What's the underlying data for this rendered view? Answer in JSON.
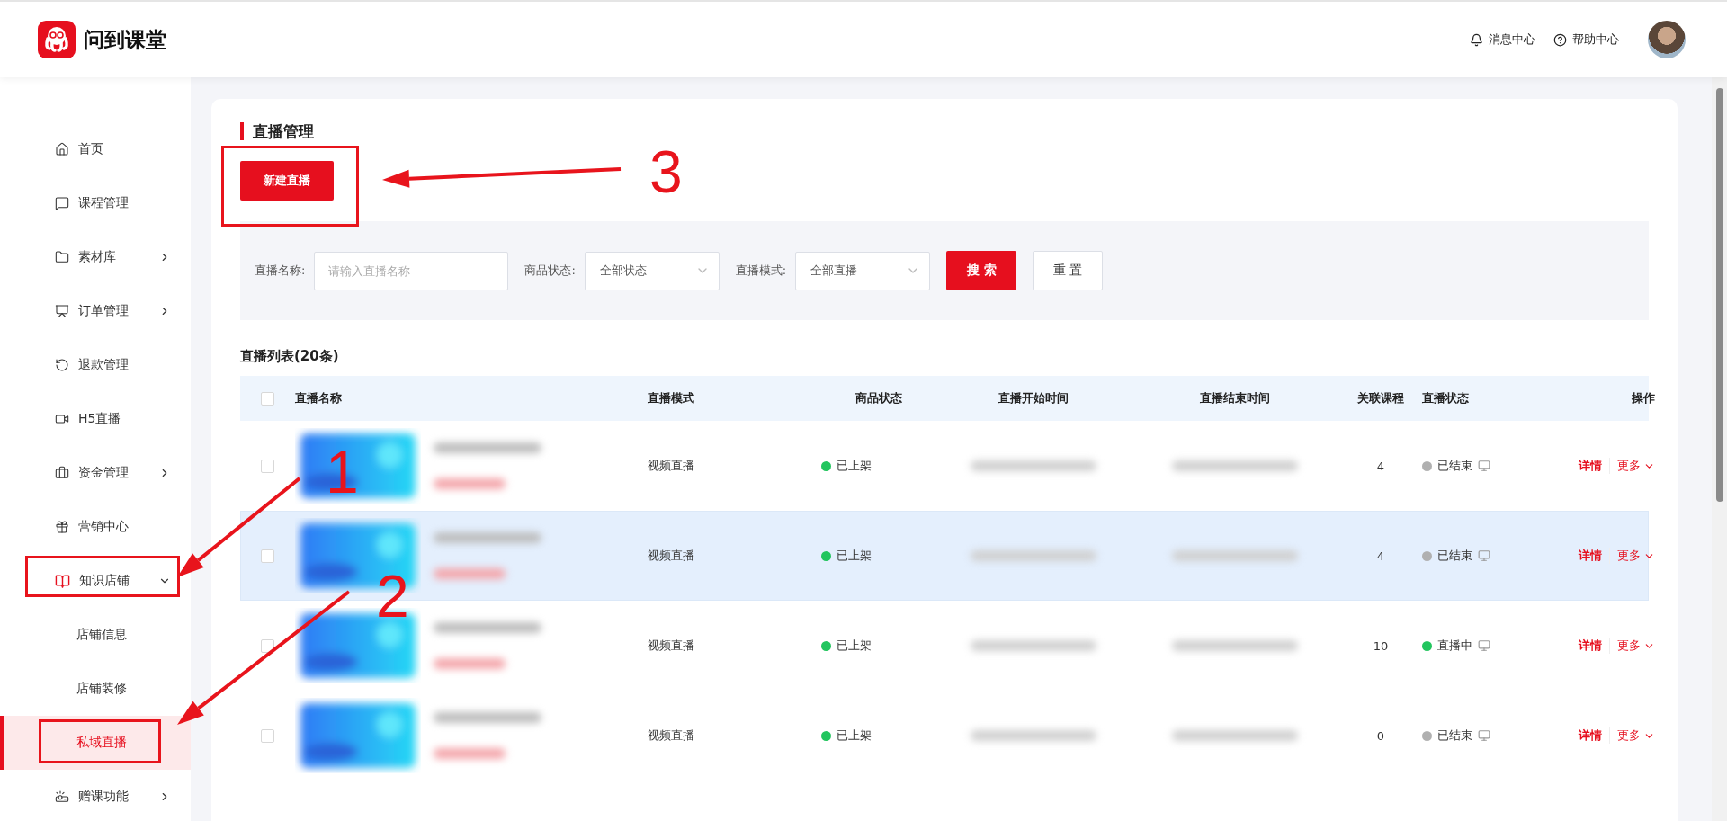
{
  "header": {
    "brand": "问到课堂",
    "links": [
      {
        "label": "消息中心"
      },
      {
        "label": "帮助中心"
      }
    ]
  },
  "sidebar": {
    "items": [
      {
        "label": "首页",
        "selected": false
      },
      {
        "label": "课程管理",
        "selected": false
      },
      {
        "label": "素材库",
        "expanded": false,
        "selected": false
      },
      {
        "label": "订单管理",
        "expanded": false,
        "selected": false
      },
      {
        "label": "退款管理",
        "selected": false
      },
      {
        "label": "H5直播",
        "selected": false
      },
      {
        "label": "资金管理",
        "expanded": false,
        "selected": false
      },
      {
        "label": "营销中心",
        "selected": false
      },
      {
        "label": "知识店铺",
        "expanded": true,
        "selected": false,
        "children": [
          {
            "label": "店铺信息",
            "selected": false
          },
          {
            "label": "店铺装修",
            "selected": false
          },
          {
            "label": "私域直播",
            "selected": true
          }
        ]
      },
      {
        "label": "赠课功能",
        "expanded": false,
        "selected": false
      }
    ]
  },
  "page": {
    "title": "直播管理",
    "primary_button": "新建直播",
    "filters": {
      "name_label": "直播名称:",
      "name_placeholder": "请输入直播名称",
      "status_label": "商品状态:",
      "status_value": "全部状态",
      "mode_label": "直播模式:",
      "mode_value": "全部直播",
      "search_button": "搜 索",
      "reset_button": "重 置"
    },
    "list_title": "直播列表(20条)",
    "table": {
      "columns": [
        "直播名称",
        "直播模式",
        "商品状态",
        "直播开始时间",
        "直播结束时间",
        "关联课程",
        "直播状态",
        "操作"
      ],
      "select_all_checked": false,
      "rows": [
        {
          "checked": false,
          "hovered": false,
          "mode": "视频直播",
          "product_status": {
            "label": "已上架",
            "color": "#22c55e"
          },
          "course_count": "4",
          "live_status": {
            "label": "已结束",
            "color": "#b0b0b0"
          },
          "actions": [
            "详情",
            "更多"
          ]
        },
        {
          "checked": false,
          "hovered": true,
          "mode": "视频直播",
          "product_status": {
            "label": "已上架",
            "color": "#22c55e"
          },
          "course_count": "4",
          "live_status": {
            "label": "已结束",
            "color": "#b0b0b0"
          },
          "actions": [
            "详情",
            "更多"
          ]
        },
        {
          "checked": false,
          "hovered": false,
          "mode": "视频直播",
          "product_status": {
            "label": "已上架",
            "color": "#22c55e"
          },
          "course_count": "10",
          "live_status": {
            "label": "直播中",
            "color": "#22c55e"
          },
          "actions": [
            "详情",
            "更多"
          ]
        },
        {
          "checked": false,
          "hovered": false,
          "mode": "视频直播",
          "product_status": {
            "label": "已上架",
            "color": "#22c55e"
          },
          "course_count": "0",
          "live_status": {
            "label": "已结束",
            "color": "#b0b0b0"
          },
          "actions": [
            "详情",
            "更多"
          ]
        }
      ]
    }
  },
  "annotations": [
    {
      "label": "1"
    },
    {
      "label": "2"
    },
    {
      "label": "3"
    }
  ]
}
